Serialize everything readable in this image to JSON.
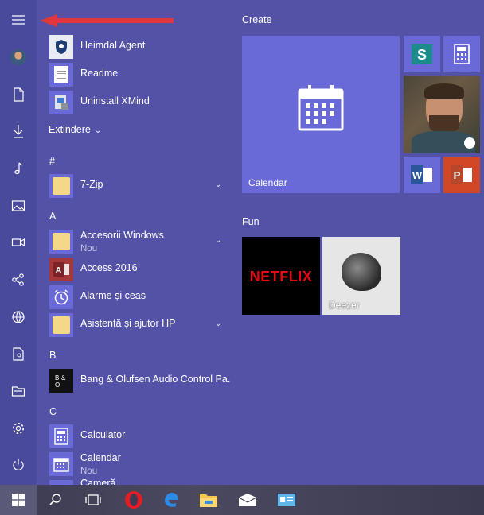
{
  "apps": {
    "heimdal": "Heimdal Agent",
    "readme": "Readme",
    "uninstall": "Uninstall XMind",
    "expand_label": "Extindere",
    "hash": "#",
    "zip": "7-Zip",
    "letter_a": "A",
    "accesorii": "Accesorii Windows",
    "accesorii_badge": "Nou",
    "access": "Access 2016",
    "alarme": "Alarme și ceas",
    "asistenta": "Asistență și ajutor HP",
    "letter_b": "B",
    "bang": "Bang & Olufsen Audio Control Pa...",
    "letter_c": "C",
    "calculator": "Calculator",
    "calendar": "Calendar",
    "calendar_badge": "Nou",
    "camera": "Cameră"
  },
  "tiles": {
    "group_create": "Create",
    "calendar_label": "Calendar",
    "group_fun": "Fun",
    "netflix_text": "NETFLIX",
    "deezer_label": "Deezer"
  },
  "colors": {
    "start_bg": "#5352a6",
    "tile_accent": "#6a69d8",
    "word": "#2b579a",
    "powerpoint": "#d24726",
    "netflix_red": "#e50914",
    "arrow_red": "#e0383a"
  }
}
